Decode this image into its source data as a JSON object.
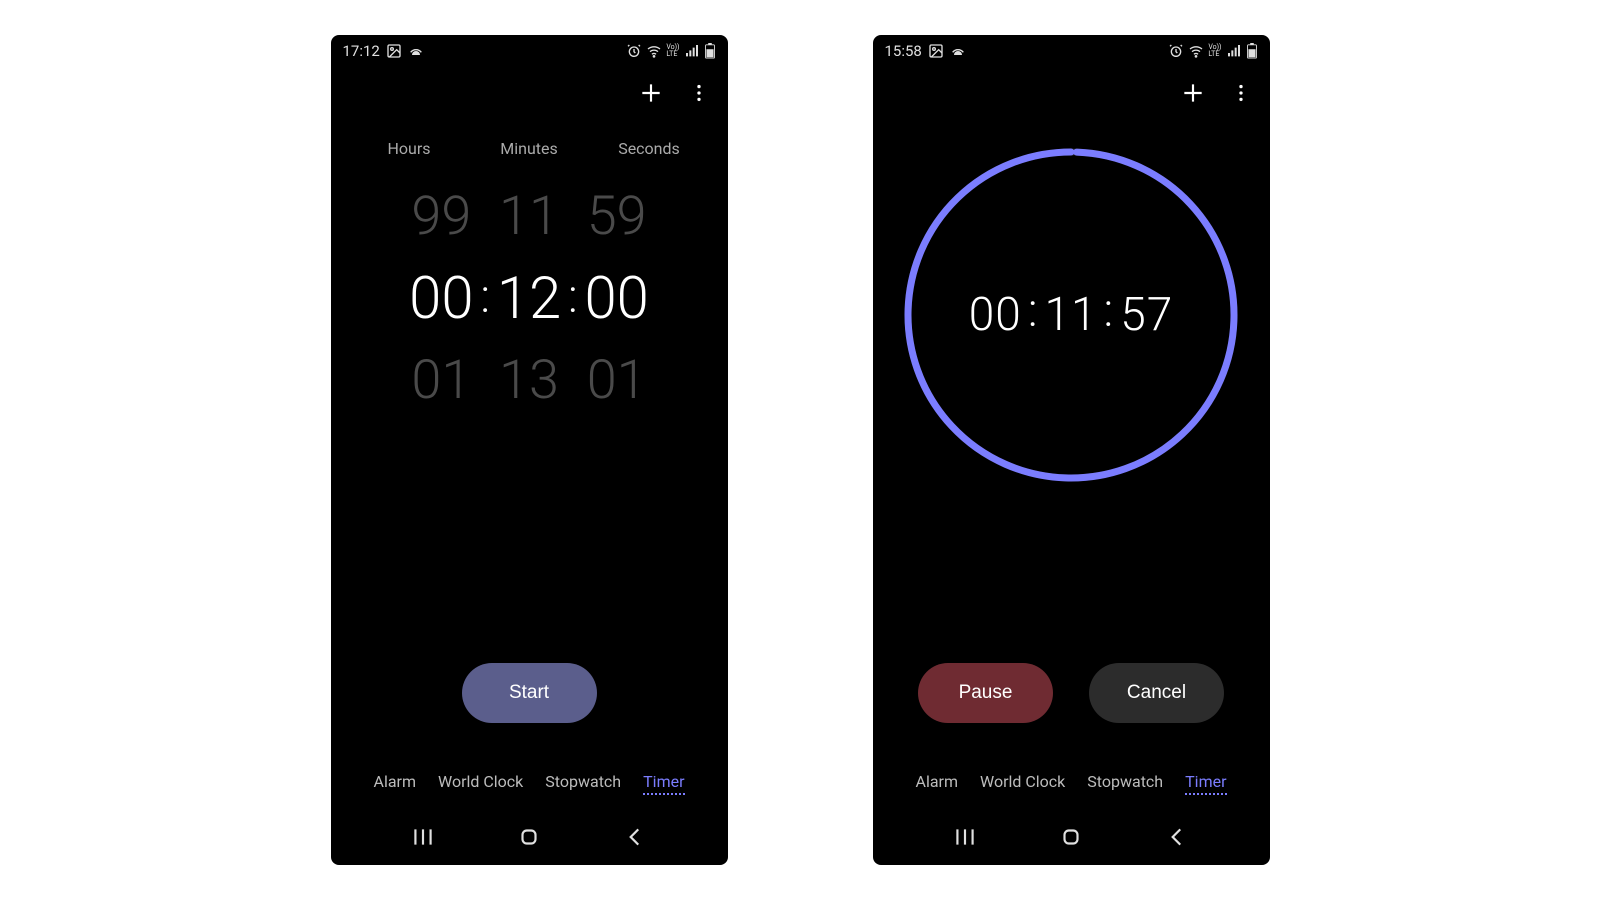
{
  "left": {
    "status": {
      "time": "17:12",
      "volte": "Vo))\nLTE"
    },
    "picker": {
      "labels": {
        "hours": "Hours",
        "minutes": "Minutes",
        "seconds": "Seconds"
      },
      "hours": {
        "prev": "99",
        "cur": "00",
        "next": "01"
      },
      "minutes": {
        "prev": "11",
        "cur": "12",
        "next": "13"
      },
      "seconds": {
        "prev": "59",
        "cur": "00",
        "next": "01"
      },
      "colon": ":"
    },
    "buttons": {
      "start": "Start"
    },
    "tabs": {
      "alarm": "Alarm",
      "world": "World Clock",
      "stopwatch": "Stopwatch",
      "timer": "Timer"
    }
  },
  "right": {
    "status": {
      "time": "15:58",
      "volte": "Vo))\nLTE"
    },
    "countdown": {
      "hh": "00",
      "mm": "11",
      "ss": "57",
      "colon": ":",
      "ring_color": "#7b7dff"
    },
    "buttons": {
      "pause": "Pause",
      "cancel": "Cancel"
    },
    "tabs": {
      "alarm": "Alarm",
      "world": "World Clock",
      "stopwatch": "Stopwatch",
      "timer": "Timer"
    }
  }
}
